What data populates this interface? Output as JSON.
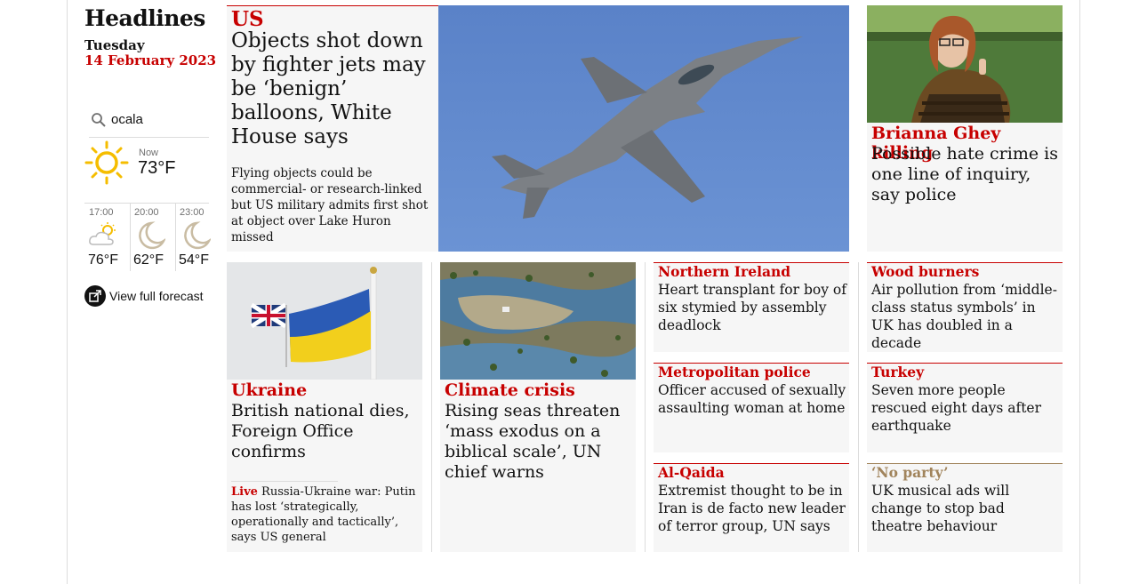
{
  "sidebar": {
    "heading": "Headlines",
    "day": "Tuesday",
    "date": "14 February 2023"
  },
  "weather": {
    "location": "ocala",
    "now_label": "Now",
    "now_temp": "73°F",
    "now_icon": "sun-icon",
    "forecast": [
      {
        "time": "17:00",
        "temp": "76°F",
        "icon": "partly-cloudy-icon"
      },
      {
        "time": "20:00",
        "temp": "62°F",
        "icon": "moon-icon"
      },
      {
        "time": "23:00",
        "temp": "54°F",
        "icon": "moon-icon"
      }
    ],
    "full_forecast_label": "View full forecast"
  },
  "lead": {
    "kicker": "US",
    "title": "Objects shot down by fighter jets may be ‘benign’ balloons, White House says",
    "standfirst": "Flying objects could be commercial- or research-linked but US military admits first shot at object over Lake Huron missed"
  },
  "brianna": {
    "kicker": "Brianna Ghey killing",
    "title": "Possible hate crime is one line of inquiry, say police"
  },
  "ukraine": {
    "kicker": "Ukraine",
    "title": "British national dies, Foreign Office confirms",
    "live_label": "Live",
    "live_text": "Russia-Ukraine war: Putin has lost ‘strategically, operationally and tactically’, says US general"
  },
  "climate": {
    "kicker": "Climate crisis",
    "title": "Rising seas threaten ‘mass exodus on a biblical scale’, UN chief warns"
  },
  "small_cards": [
    {
      "kicker": "Northern Ireland",
      "title": "Heart transplant for boy of six stymied by assembly deadlock"
    },
    {
      "kicker": "Wood burners",
      "title": "Air pollution from ‘middle-class status symbols’ in UK has doubled in a decade"
    },
    {
      "kicker": "Metropolitan police",
      "title": "Officer accused of sexually assaulting woman at home"
    },
    {
      "kicker": "Turkey",
      "title": "Seven more people rescued eight days after earthquake"
    },
    {
      "kicker": "Al-Qaida",
      "title": "Extremist thought to be in Iran is de facto new leader of terror group, UN says"
    },
    {
      "kicker": "‘No party’",
      "title": "UK musical ads will change to stop bad theatre behaviour"
    }
  ],
  "colors": {
    "news_red": "#c70000",
    "culture_brown": "#a1845c",
    "card_bg": "#f6f6f6"
  }
}
